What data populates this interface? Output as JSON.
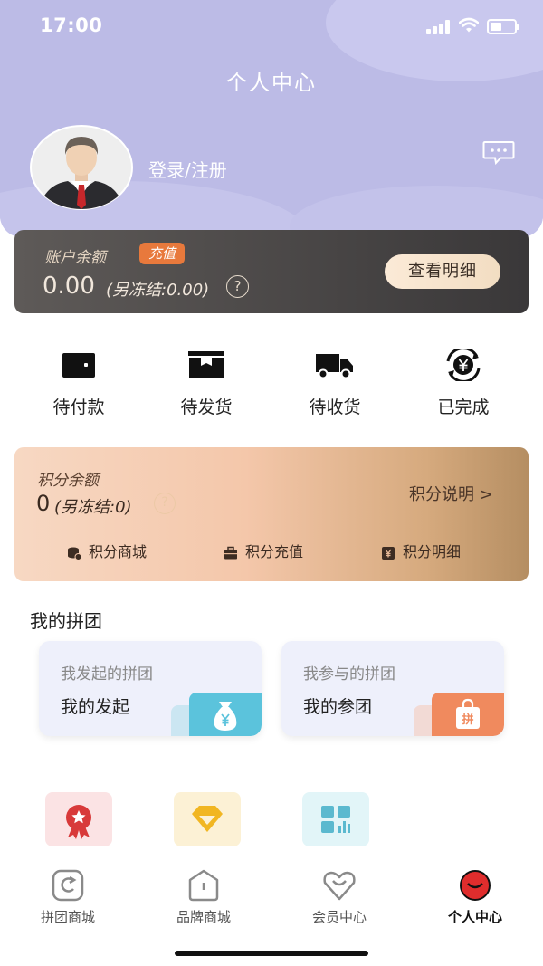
{
  "status_bar": {
    "time": "17:00"
  },
  "header": {
    "title": "个人中心",
    "login_text": "登录/注册"
  },
  "balance": {
    "label": "账户余额",
    "recharge_label": "充值",
    "value": "0.00",
    "frozen": "(另冻结:0.00)",
    "help": "?",
    "detail_button": "查看明细"
  },
  "orders": [
    {
      "label": "待付款",
      "icon": "wallet-icon"
    },
    {
      "label": "待发货",
      "icon": "box-icon"
    },
    {
      "label": "待收货",
      "icon": "truck-icon"
    },
    {
      "label": "已完成",
      "icon": "yen-coin-icon"
    }
  ],
  "points": {
    "label": "积分余额",
    "value": "0",
    "frozen": "(另冻结:0)",
    "help": "?",
    "explain": "积分说明 >",
    "links": [
      {
        "label": "积分商城",
        "icon": "coins-icon"
      },
      {
        "label": "积分充值",
        "icon": "briefcase-icon"
      },
      {
        "label": "积分明细",
        "icon": "yen-card-icon"
      }
    ]
  },
  "group_buy": {
    "title": "我的拼团",
    "cards": [
      {
        "subtitle": "我发起的拼团",
        "title": "我的发起",
        "icon": "money-bag-icon",
        "color": "#5bc3dc"
      },
      {
        "subtitle": "我参与的拼团",
        "title": "我的参团",
        "icon": "shopping-bag-icon",
        "color": "#f08a5e"
      }
    ]
  },
  "services": [
    {
      "icon": "award-icon",
      "bg": "#fbe3e4",
      "fg": "#d83a3a"
    },
    {
      "icon": "diamond-icon",
      "bg": "#fcf1d5",
      "fg": "#f1b622"
    },
    {
      "icon": "grid-icon",
      "bg": "#e2f5f8",
      "fg": "#5bb9cf"
    }
  ],
  "tabbar": {
    "items": [
      {
        "label": "拼团商城",
        "icon": "group-shop-icon",
        "active": false
      },
      {
        "label": "品牌商城",
        "icon": "brand-shop-icon",
        "active": false
      },
      {
        "label": "会员中心",
        "icon": "member-heart-icon",
        "active": false
      },
      {
        "label": "个人中心",
        "icon": "profile-face-icon",
        "active": true
      }
    ]
  },
  "colors": {
    "header_bg": "#bcbbe6",
    "recharge_badge": "#e8793c",
    "active_tab": "#e02d2d"
  }
}
